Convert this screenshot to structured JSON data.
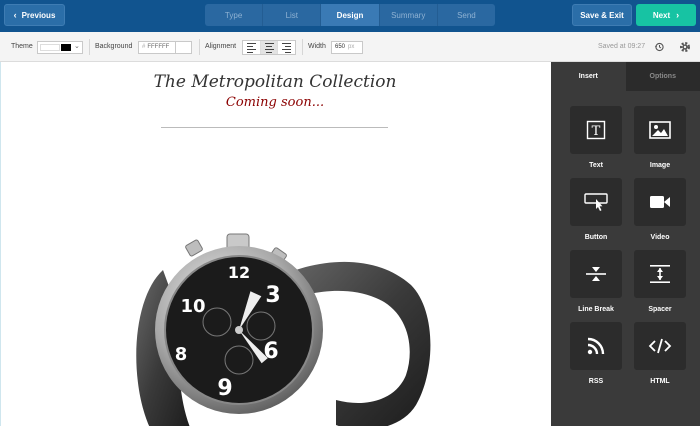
{
  "header": {
    "previous_label": "Previous",
    "steps": [
      "Type",
      "List",
      "Design",
      "Summary",
      "Send"
    ],
    "active_step": "Design",
    "save_exit_label": "Save & Exit",
    "next_label": "Next"
  },
  "toolbar": {
    "theme_label": "Theme",
    "background_label": "Background",
    "background_value": "FFFFFF",
    "alignment_label": "Alignment",
    "alignment_selected": "center",
    "width_label": "Width",
    "width_value": "650",
    "width_unit": "px",
    "saved_text": "Saved at 09:27"
  },
  "canvas": {
    "title": "The Metropolitan Collection",
    "subtitle": "Coming soon..."
  },
  "sidebar": {
    "tabs": [
      "Insert",
      "Options"
    ],
    "active_tab": "Insert",
    "blocks": [
      {
        "label": "Text",
        "icon": "text-icon"
      },
      {
        "label": "Image",
        "icon": "image-icon"
      },
      {
        "label": "Button",
        "icon": "button-icon"
      },
      {
        "label": "Video",
        "icon": "video-icon"
      },
      {
        "label": "Line Break",
        "icon": "line-break-icon"
      },
      {
        "label": "Spacer",
        "icon": "spacer-icon"
      },
      {
        "label": "RSS",
        "icon": "rss-icon"
      },
      {
        "label": "HTML",
        "icon": "html-icon"
      }
    ]
  },
  "colors": {
    "header_bg": "#11548f",
    "next_button": "#17c3a3",
    "subtitle": "#8b0000",
    "sidebar_bg": "#3a3a3a"
  }
}
